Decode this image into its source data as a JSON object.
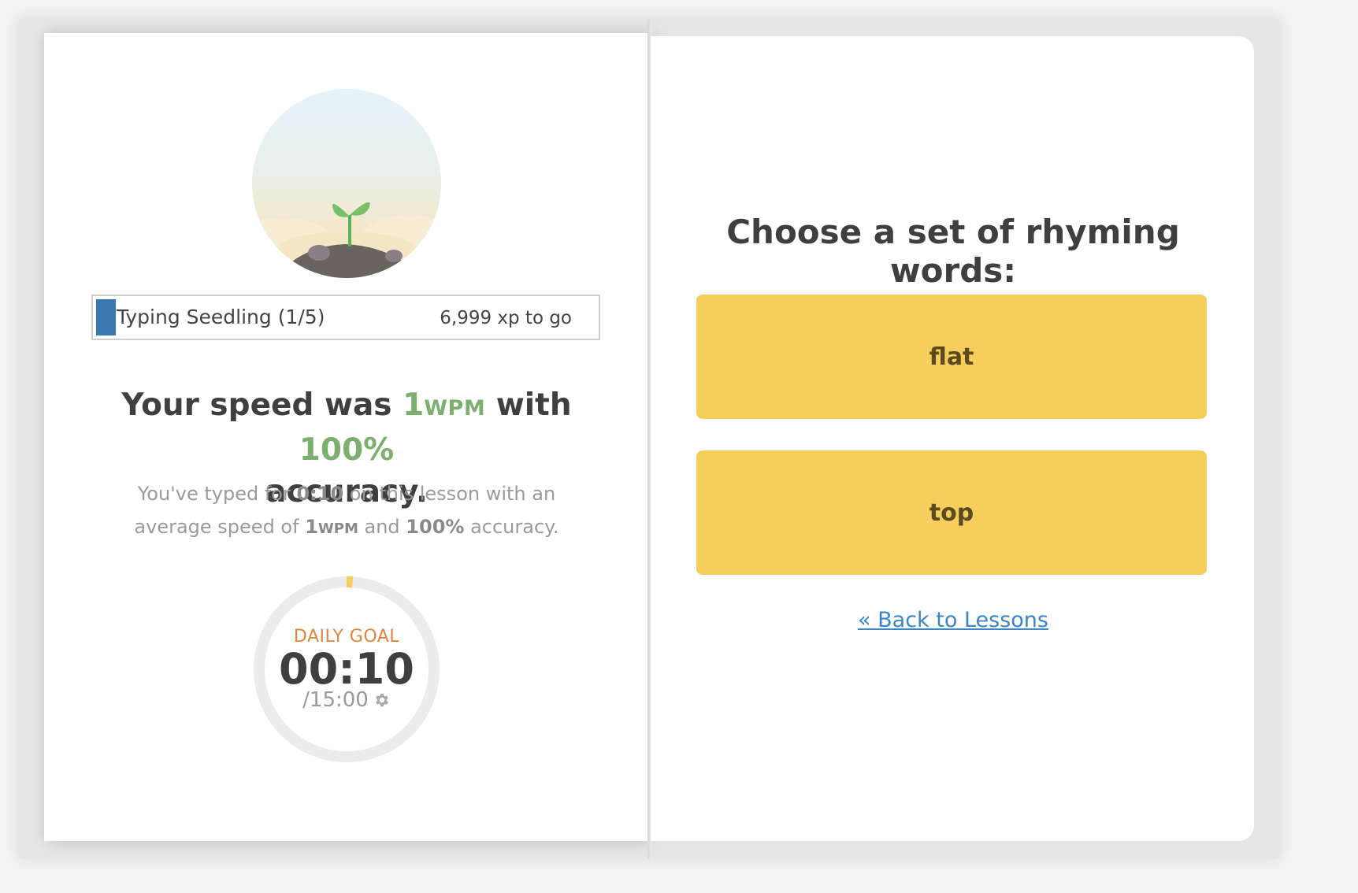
{
  "level": {
    "name": "Typing Seedling (1/5)",
    "xp_remaining": "6,999 xp to go",
    "progress_fraction": 0.004,
    "fill_color": "#3b78b1"
  },
  "result": {
    "prefix": "Your speed was ",
    "speed": "1",
    "speed_unit": "WPM",
    "middle": " with ",
    "accuracy": "100%",
    "suffix": " accuracy."
  },
  "summary": {
    "part1": "You've typed for ",
    "time": "0:10",
    "part2": " on this lesson with an average speed of ",
    "speed": "1",
    "speed_unit": "WPM",
    "part3": " and ",
    "accuracy": "100%",
    "part4": " accuracy."
  },
  "daily_goal": {
    "label": "DAILY GOAL",
    "elapsed": "00:10",
    "target": "/15:00",
    "progress_fraction": 0.011,
    "progress_color": "#f6ce5c"
  },
  "question": {
    "title": "Choose a set of rhyming words:",
    "choices": [
      "flat",
      "top"
    ]
  },
  "back_link": "« Back to Lessons",
  "colors": {
    "accent_green": "#7daf6e",
    "choice_yellow": "#f6ce5c",
    "link_blue": "#3b86c8",
    "goal_orange": "#e0873d"
  }
}
